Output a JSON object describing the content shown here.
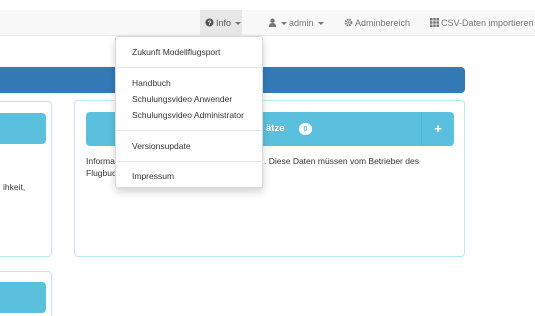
{
  "navbar": {
    "info_label": "Info",
    "admin_label": "admin",
    "adminbereich_label": "Adminbereich",
    "csv_label": "CSV-Daten importieren"
  },
  "icons": {
    "info": "question-circle-icon",
    "admin": "user-icon",
    "adminbereich": "gear-icon",
    "csv": "grid-icon"
  },
  "dropdown": {
    "items": [
      "Zukunft Modellflugsport",
      "Handbuch",
      "Schulungsvideo Anwender",
      "Schulungsvideo Administrator",
      "Versionsupdate",
      "Impressum"
    ]
  },
  "left_panel": {
    "text": "ihkeit,"
  },
  "main_panel": {
    "title_fragment": "ätze",
    "count": "0",
    "plus": "+",
    "text_start_1": "Informa",
    "text_start_2": "Flugbuc",
    "text_tail": ". Diese Daten müssen vom Betrieber des"
  },
  "colors": {
    "primary": "#337ab7",
    "info": "#5bc0de",
    "navbar_bg": "#f8f8f8",
    "panel_border": "#bce8f1"
  }
}
